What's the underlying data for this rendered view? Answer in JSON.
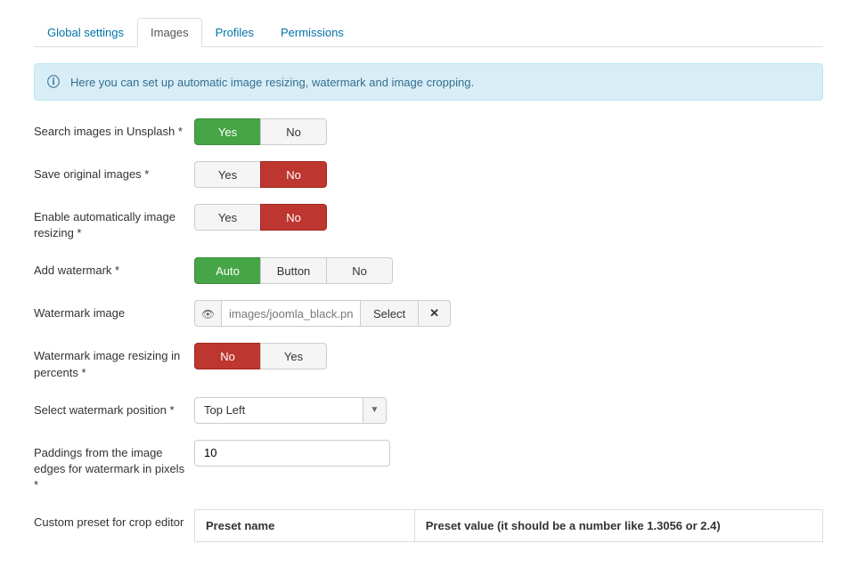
{
  "tabs": {
    "global": "Global settings",
    "images": "Images",
    "profiles": "Profiles",
    "permissions": "Permissions"
  },
  "alert": "Here you can set up automatic image resizing, watermark and image cropping.",
  "fields": {
    "unsplash": {
      "label": "Search images in Unsplash *",
      "yes": "Yes",
      "no": "No"
    },
    "saveOriginal": {
      "label": "Save original images *",
      "yes": "Yes",
      "no": "No"
    },
    "autoResize": {
      "label": "Enable automatically image resizing *",
      "yes": "Yes",
      "no": "No"
    },
    "watermark": {
      "label": "Add watermark *",
      "auto": "Auto",
      "button": "Button",
      "no": "No"
    },
    "watermarkImage": {
      "label": "Watermark image",
      "value": "images/joomla_black.png",
      "select": "Select"
    },
    "watermarkResize": {
      "label": "Watermark image resizing in percents *",
      "no": "No",
      "yes": "Yes"
    },
    "watermarkPosition": {
      "label": "Select watermark position *",
      "value": "Top Left"
    },
    "paddings": {
      "label": "Paddings from the image edges for watermark in pixels *",
      "value": "10"
    },
    "preset": {
      "label": "Custom preset for crop editor",
      "col1": "Preset name",
      "col2": "Preset value (it should be a number like 1.3056 or 2.4)"
    }
  }
}
